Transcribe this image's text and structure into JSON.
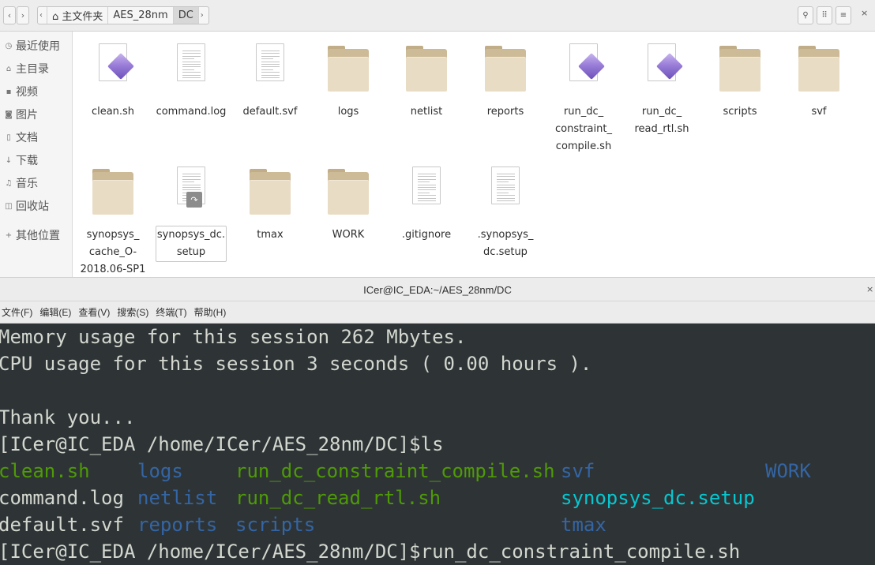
{
  "file_manager": {
    "nav": {
      "back_glyph": "‹",
      "forward_glyph": "›",
      "path_left_glyph": "‹",
      "path_right_glyph": "›"
    },
    "path": [
      {
        "label": "⌂ 主文件夹"
      },
      {
        "label": "AES_28nm"
      },
      {
        "label": "DC"
      }
    ],
    "header_buttons": {
      "search_glyph": "⚲",
      "view_glyph": "⠿",
      "menu_glyph": "≡",
      "close_glyph": "×"
    },
    "sidebar": [
      {
        "icon": "clock-icon",
        "glyph": "◷",
        "label": "最近使用"
      },
      {
        "icon": "home-icon",
        "glyph": "⌂",
        "label": "主目录"
      },
      {
        "icon": "video-icon",
        "glyph": "▪",
        "label": "视频"
      },
      {
        "icon": "camera-icon",
        "glyph": "◙",
        "label": "图片"
      },
      {
        "icon": "document-icon",
        "glyph": "▯",
        "label": "文档"
      },
      {
        "icon": "download-icon",
        "glyph": "↓",
        "label": "下载"
      },
      {
        "icon": "music-icon",
        "glyph": "♫",
        "label": "音乐"
      },
      {
        "icon": "trash-icon",
        "glyph": "◫",
        "label": "回收站"
      },
      {
        "icon": "plus-icon",
        "glyph": "+",
        "label": "其他位置"
      }
    ],
    "files": [
      {
        "type": "script",
        "name_lines": [
          "clean.sh"
        ]
      },
      {
        "type": "text",
        "name_lines": [
          "command.log"
        ]
      },
      {
        "type": "text",
        "name_lines": [
          "default.svf"
        ]
      },
      {
        "type": "folder",
        "name_lines": [
          "logs"
        ]
      },
      {
        "type": "folder",
        "name_lines": [
          "netlist"
        ]
      },
      {
        "type": "folder",
        "name_lines": [
          "reports"
        ]
      },
      {
        "type": "script",
        "name_lines": [
          "run_dc_",
          "constraint_",
          "compile.sh"
        ]
      },
      {
        "type": "script",
        "name_lines": [
          "run_dc_",
          "read_rtl.sh"
        ]
      },
      {
        "type": "folder",
        "name_lines": [
          "scripts"
        ]
      },
      {
        "type": "folder",
        "name_lines": [
          "svf"
        ]
      },
      {
        "type": "folder",
        "name_lines": [
          "synopsys_",
          "cache_O-",
          "2018.06-SP1"
        ]
      },
      {
        "type": "link",
        "name_lines": [
          "synopsys_dc.",
          "setup"
        ],
        "selected": true,
        "badge_glyph": "↷"
      },
      {
        "type": "folder",
        "name_lines": [
          "tmax"
        ]
      },
      {
        "type": "folder",
        "name_lines": [
          "WORK"
        ]
      },
      {
        "type": "text",
        "name_lines": [
          ".gitignore"
        ]
      },
      {
        "type": "text",
        "name_lines": [
          ".synopsys_",
          "dc.setup"
        ]
      }
    ]
  },
  "terminal": {
    "title": "ICer@IC_EDA:~/AES_28nm/DC",
    "close_glyph": "×",
    "menu": [
      "文件(F)",
      "编辑(E)",
      "查看(V)",
      "搜索(S)",
      "终端(T)",
      "帮助(H)"
    ],
    "colors": {
      "background": "#2e3436",
      "foreground": "#d3d7cf",
      "exec": "#4e9a06",
      "dir": "#3465a4",
      "link": "#06c7d0"
    },
    "lines": [
      "Memory usage for this session 262 Mbytes.",
      "CPU usage for this session 3 seconds ( 0.00 hours ).",
      "",
      "Thank you...",
      "[ICer@IC_EDA /home/ICer/AES_28nm/DC]$ls"
    ],
    "ls_rows": [
      [
        {
          "text": "clean.sh",
          "kind": "exec",
          "col": 0
        },
        {
          "text": "logs",
          "kind": "dir",
          "col": 1
        },
        {
          "text": "run_dc_constraint_compile.sh",
          "kind": "exec",
          "col": 2
        },
        {
          "text": "svf",
          "kind": "dir",
          "col": 3
        },
        {
          "text": "WORK",
          "kind": "dir",
          "col": 4
        }
      ],
      [
        {
          "text": "command.log",
          "kind": "plain",
          "col": 0
        },
        {
          "text": "netlist",
          "kind": "dir",
          "col": 1
        },
        {
          "text": "run_dc_read_rtl.sh",
          "kind": "exec",
          "col": 2
        },
        {
          "text": "synopsys_dc.setup",
          "kind": "link",
          "col": 3
        }
      ],
      [
        {
          "text": "default.svf",
          "kind": "plain",
          "col": 0
        },
        {
          "text": "reports",
          "kind": "dir",
          "col": 1
        },
        {
          "text": "scripts",
          "kind": "dir",
          "col": 2
        },
        {
          "text": "tmax",
          "kind": "dir",
          "col": 3
        }
      ]
    ],
    "last_line": "[ICer@IC_EDA /home/ICer/AES_28nm/DC]$run_dc_constraint_compile.sh"
  }
}
